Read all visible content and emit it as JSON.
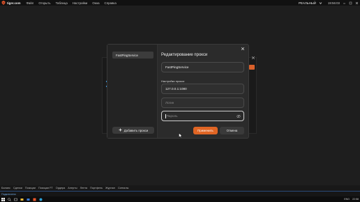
{
  "app": {
    "brand": "tiger.com",
    "menu": [
      "Файл",
      "Открыть",
      "Таблица",
      "Настройки",
      "Окна",
      "Справка"
    ],
    "account": "РЕАЛЬНЫЙ",
    "clock": "19:56:03"
  },
  "dialog": {
    "title": "Редактирование прокси",
    "proxy_list": [
      "FastPingService"
    ],
    "name_value": "FastPingService",
    "settings_label": "Настройки прокси",
    "address_value": "127.0.0.1:1080",
    "login_placeholder": "Логин",
    "password_placeholder": "Пароль",
    "add_proxy_label": "Добавить прокси",
    "apply_label": "Применить",
    "cancel_label": "Отмена"
  },
  "bottom_tabs": [
    "Баланс",
    "Сделки",
    "Позиции",
    "Позиции FT",
    "Ордера",
    "Алерты",
    "Лента",
    "Портфель",
    "Журнал",
    "Сигналы"
  ],
  "statusline": "Подключено",
  "taskbar": {
    "lang": "ENG",
    "time": "22:58"
  },
  "colors": {
    "accent": "#e06524",
    "dialog_bg": "#2b2b2b",
    "workspace_bg": "#1e1e1e"
  }
}
